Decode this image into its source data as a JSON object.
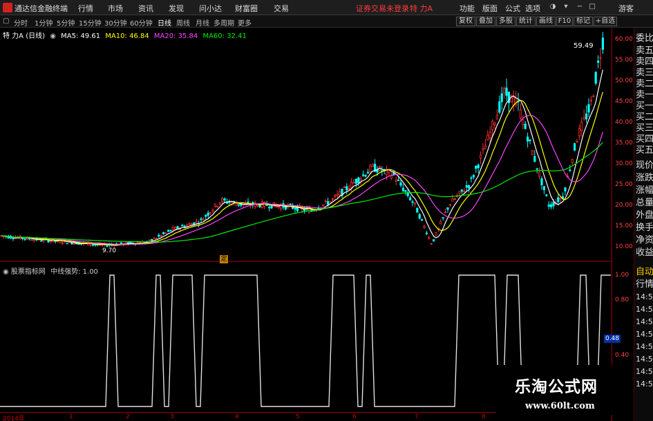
{
  "app": {
    "title": "通达信金融终端",
    "notice": "证券交易未登录",
    "stock_name": "特 力A"
  },
  "menu": [
    "行情",
    "市场",
    "资讯",
    "发现",
    "问小达",
    "财富圈",
    "交易"
  ],
  "right_menu": [
    "功能",
    "版面",
    "公式",
    "选项",
    "游客"
  ],
  "periods": [
    "分时",
    "1分钟",
    "5分钟",
    "15分钟",
    "30分钟",
    "60分钟",
    "日线",
    "周线",
    "月线",
    "多周期",
    "更多"
  ],
  "active_period": "日线",
  "tool_buttons": [
    "复权",
    "叠加",
    "多股",
    "统计",
    "画线",
    "F10",
    "标记",
    "+自选"
  ],
  "ma": {
    "title": "特 力A (日线)",
    "ma5": "MA5: 49.61",
    "ma10": "MA10: 46.84",
    "ma20": "MA20: 35.84",
    "ma60": "MA60: 32.41",
    "colors": {
      "ma5": "#ffffff",
      "ma10": "#ffff00",
      "ma20": "#ff44ff",
      "ma60": "#00ee00",
      "up": "#ff3030",
      "down": "#00ffff"
    }
  },
  "price_axis": [
    "60.00",
    "55.00",
    "50.00",
    "45.00",
    "40.00",
    "35.00",
    "30.00",
    "25.00",
    "20.00",
    "15.00",
    "10.00"
  ],
  "price_labels": {
    "high": "59.49",
    "low": "9.70",
    "marker": "定"
  },
  "indicator": {
    "name": "股票指标网",
    "label": "中线强势: 1.00",
    "axis": [
      "1.00",
      "0.80",
      "0.48",
      "0.40"
    ],
    "current": "0.48"
  },
  "side_panel": [
    "委比",
    "卖五",
    "卖四",
    "卖三",
    "卖二",
    "卖一",
    "买一",
    "买二",
    "买三",
    "买四",
    "买五",
    "现价",
    "涨跌",
    "涨幅",
    "总量",
    "外盘",
    "换手",
    "净资",
    "收益"
  ],
  "side_panel2": [
    "自动",
    "行情",
    "14:5",
    "14:5",
    "14:5",
    "14:5",
    "14:5",
    "14:5",
    "14:5",
    "14:5"
  ],
  "dates": [
    "2014年",
    "1",
    "2",
    "3",
    "4",
    "5",
    "6",
    "7",
    "8"
  ],
  "watermark": {
    "line1": "乐淘公式网",
    "line2": "www.60lt.com"
  },
  "chart_data": {
    "type": "candlestick",
    "price_range": [
      8,
      62
    ],
    "indicator_range": [
      0,
      1
    ],
    "last_close": 59.49,
    "min_low": 9.7
  }
}
